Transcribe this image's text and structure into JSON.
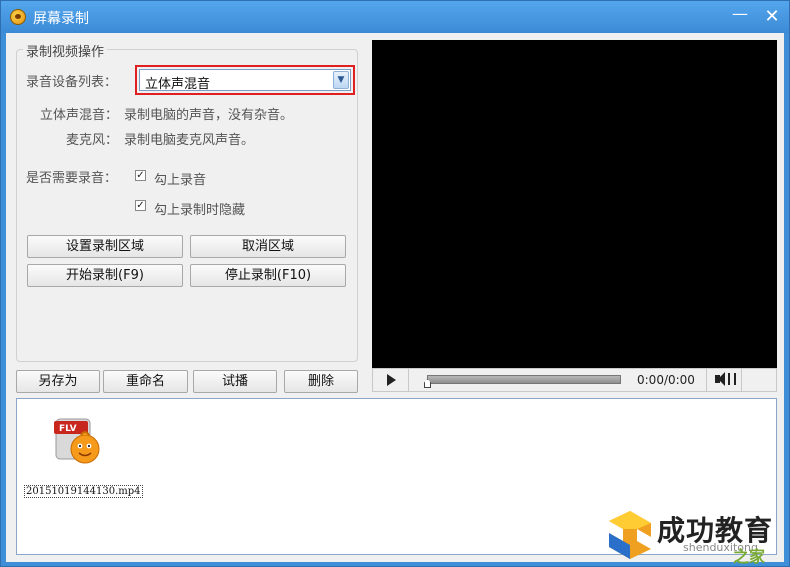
{
  "window": {
    "title": "屏幕录制",
    "minimize_glyph": "—",
    "close_glyph": "✕"
  },
  "record_group": {
    "legend": "录制视频操作",
    "device_label": "录音设备列表：",
    "device_value": "立体声混音",
    "stereo_desc_label": "立体声混音：",
    "stereo_desc_text": "录制电脑的声音，没有杂音。",
    "mic_desc_label": "麦克风：",
    "mic_desc_text": "录制电脑麦克风声音。",
    "need_audio_label": "是否需要录音：",
    "check_audio_label": "勾上录音",
    "check_audio_checked": true,
    "check_hide_label": "勾上录制时隐藏",
    "check_hide_checked": true,
    "set_region_button": "设置录制区域",
    "cancel_region_button": "取消区域",
    "start_button": "开始录制(F9)",
    "stop_button": "停止录制(F10)"
  },
  "file_actions": {
    "save_as": "另存为",
    "rename": "重命名",
    "preview": "试播",
    "delete": "删除"
  },
  "player": {
    "time": "0:00/0:00",
    "progress": 0
  },
  "files": [
    {
      "name": "20151019144130.mp4",
      "icon": "flv-file-icon",
      "badge": "FLV"
    }
  ],
  "watermark": {
    "text": "成功教育",
    "url": "shenduxitong",
    "suffix": "之家"
  },
  "colors": {
    "titlebar": "#3f8fd8",
    "highlight_border": "#e02020",
    "video_bg": "#000000"
  }
}
